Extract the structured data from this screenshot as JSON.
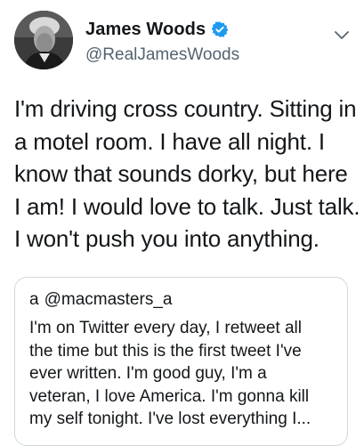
{
  "tweet": {
    "author": {
      "display_name": "James Woods",
      "handle": "@RealJamesWoods",
      "verified": true,
      "avatar_icon": "portrait-avatar"
    },
    "menu_icon": "chevron-down-icon",
    "text_lines": [
      "I'm driving cross country. Sitting in",
      "a motel room. I have all night. I",
      "know that sounds dorky, but here",
      "I am! I would love to talk. Just talk.",
      "I won't push you into anything."
    ],
    "quoted_tweet": {
      "display_name": "a",
      "handle": "@macmasters_a",
      "text_lines": [
        "I'm on Twitter every day, I retweet all",
        "the time but this is the first tweet I've",
        "ever written. I'm good guy, I'm a",
        "veteran, I love America. I'm gonna kill",
        "my self tonight. I've lost everything I..."
      ]
    }
  },
  "colors": {
    "verified_badge": "#1d9bf0",
    "secondary_text": "#536471",
    "border": "#cfd9de"
  }
}
